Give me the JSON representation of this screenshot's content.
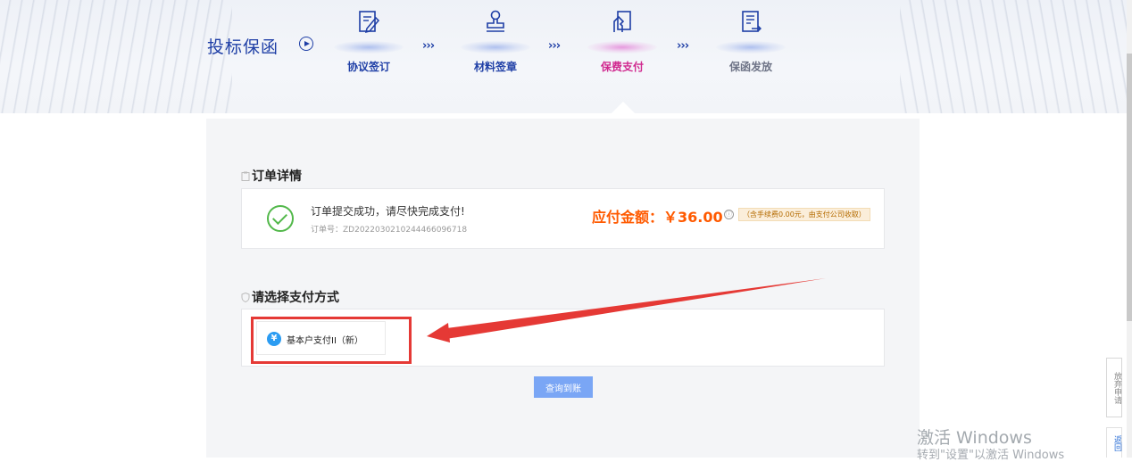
{
  "header": {
    "title": "投标保函",
    "steps": [
      {
        "label": "协议签订",
        "icon": "edit-document-icon",
        "state": "done"
      },
      {
        "label": "材料签章",
        "icon": "stamp-icon",
        "state": "done"
      },
      {
        "label": "保费支付",
        "icon": "payment-icon",
        "state": "active"
      },
      {
        "label": "保函发放",
        "icon": "document-send-icon",
        "state": "pending"
      }
    ],
    "separator": "›››"
  },
  "order": {
    "section_title": "订单详情",
    "message": "订单提交成功，请尽快完成支付!",
    "order_no": "订单号：ZD2022030210244466096718",
    "pay_amount": "应付金额：￥36.00",
    "info_icon": "ⓘ",
    "fee_note": "（含手续费0.00元，由支付公司收取）"
  },
  "payment": {
    "section_title": "请选择支付方式",
    "method_label": "基本户支付II（新）",
    "method_icon": "yen-icon",
    "query_button": "查询到账"
  },
  "side": {
    "abandon": "放弃申请",
    "back": "返回"
  },
  "watermark": {
    "line1": "激活 Windows",
    "line2": "转到\"设置\"以激活 Windows"
  },
  "colors": {
    "brand": "#1f3fa6",
    "active_step": "#d0298f",
    "amount": "#ff5a00",
    "success": "#52b84a",
    "highlight": "#e53935",
    "button": "#7aa6f5"
  }
}
